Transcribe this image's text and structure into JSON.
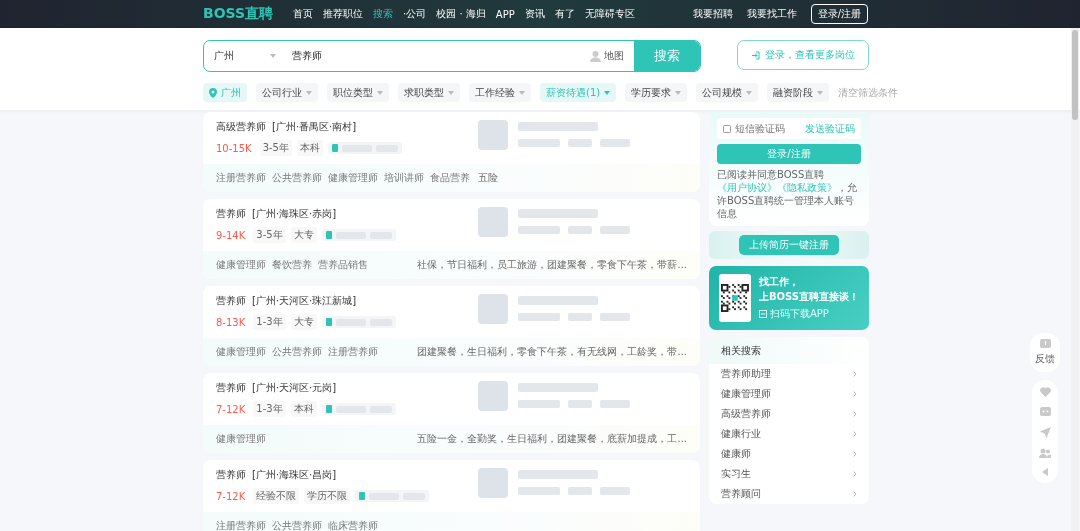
{
  "nav": {
    "logo": "BOSS直聘",
    "items": [
      {
        "label": "首页",
        "selected": false
      },
      {
        "label": "推荐职位",
        "selected": false
      },
      {
        "label": "搜索",
        "selected": true
      },
      {
        "label": "·公司",
        "selected": false
      },
      {
        "label": "校园 · 海归",
        "selected": false
      },
      {
        "label": "APP",
        "selected": false
      },
      {
        "label": "资讯",
        "selected": false
      },
      {
        "label": "有了",
        "selected": false
      },
      {
        "label": "无障碍专区",
        "selected": false
      }
    ],
    "right_links": [
      "我要招聘",
      "我要找工作"
    ],
    "login_button": "登录/注册"
  },
  "search": {
    "city": "广州",
    "value": "营养师",
    "map_label": "地图",
    "button": "搜索",
    "login_prompt": "登录，查看更多岗位"
  },
  "filters": [
    {
      "label": "广州",
      "kind": "location",
      "selected": true
    },
    {
      "label": "公司行业",
      "kind": "dropdown",
      "selected": false
    },
    {
      "label": "职位类型",
      "kind": "dropdown",
      "selected": false
    },
    {
      "label": "求职类型",
      "kind": "dropdown",
      "selected": false
    },
    {
      "label": "工作经验",
      "kind": "dropdown",
      "selected": false
    },
    {
      "label": "薪资待遇(1)",
      "kind": "dropdown",
      "selected": true
    },
    {
      "label": "学历要求",
      "kind": "dropdown",
      "selected": false
    },
    {
      "label": "公司规模",
      "kind": "dropdown",
      "selected": false
    },
    {
      "label": "融资阶段",
      "kind": "dropdown",
      "selected": false
    }
  ],
  "clear_filters": "清空筛选条件",
  "jobs": [
    {
      "title": "高级营养师",
      "location": "[广州·番禺区·南村]",
      "salary": "10-15K",
      "tags": [
        "3-5年",
        "本科"
      ],
      "skills": [
        "注册营养师",
        "公共营养师",
        "健康管理师",
        "培训讲师",
        "食品营养"
      ],
      "welfare": "五险"
    },
    {
      "title": "营养师",
      "location": "[广州·海珠区·赤岗]",
      "salary": "9-14K",
      "tags": [
        "3-5年",
        "大专"
      ],
      "skills": [
        "健康管理师",
        "餐饮营养",
        "营养品销售"
      ],
      "welfare": "社保，节日福利，员工旅游，团建聚餐，零食下午茶，带薪..."
    },
    {
      "title": "营养师",
      "location": "[广州·天河区·珠江新城]",
      "salary": "8-13K",
      "tags": [
        "1-3年",
        "大专"
      ],
      "skills": [
        "健康管理师",
        "公共营养师",
        "注册营养师"
      ],
      "welfare": "团建聚餐，生日福利，零食下午茶，有无线网，工龄奖，带..."
    },
    {
      "title": "营养师",
      "location": "[广州·天河区·元岗]",
      "salary": "7-12K",
      "tags": [
        "1-3年",
        "本科"
      ],
      "skills": [
        "健康管理师"
      ],
      "welfare": "五险一金，全勤奖，生日福利，团建聚餐，底薪加提成，工..."
    },
    {
      "title": "营养师",
      "location": "[广州·海珠区·昌岗]",
      "salary": "7-12K",
      "tags": [
        "经验不限",
        "学历不限"
      ],
      "skills": [
        "注册营养师",
        "公共营养师",
        "临床营养师"
      ]
    }
  ],
  "login_card": {
    "code_placeholder": "短信验证码",
    "send_code": "发送验证码",
    "button": "登录/注册",
    "agreement": {
      "prefix": "已阅读并同意BOSS直聘",
      "links": [
        "《用户协议》",
        "《隐私政策》"
      ],
      "suffix": "，允许BOSS直聘统一管理本人账号信息"
    }
  },
  "upload_button": "上传简历一键注册",
  "app_promo": {
    "headline_1": "找工作，",
    "headline_2": "上BOSS直聘直接谈！",
    "caption": "扫码下载APP"
  },
  "related": {
    "title": "相关搜索",
    "items": [
      "营养师助理",
      "健康管理师",
      "高级营养师",
      "健康行业",
      "健康师",
      "实习生",
      "营养顾问"
    ]
  },
  "side_toolbar": {
    "feedback": "反馈"
  }
}
